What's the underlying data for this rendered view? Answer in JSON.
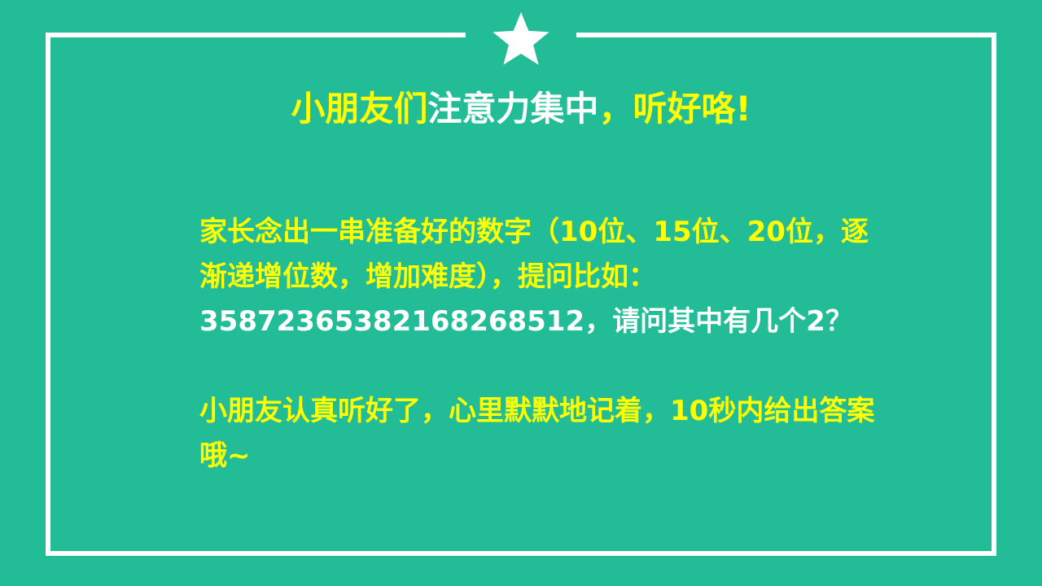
{
  "colors": {
    "background": "#22bd96",
    "frame": "#ffffff",
    "accent_text": "#ffff00",
    "body_text_alt": "#ffffff"
  },
  "icons": {
    "top_decoration": "star-icon"
  },
  "title": {
    "part1": "小朋友们",
    "part2": "注意力集中",
    "part3": "，听好咯!"
  },
  "paragraph1": {
    "part1": "家长念出一串准备好的数字（10位、15位、20位，逐渐递增位数，增加难度），提问比如：",
    "part2": "3587236538216826851​2，请问其中有几个2？"
  },
  "paragraph2": {
    "text": "小朋友认真听好了，心里默默地记着，10秒内给出答案哦~"
  }
}
